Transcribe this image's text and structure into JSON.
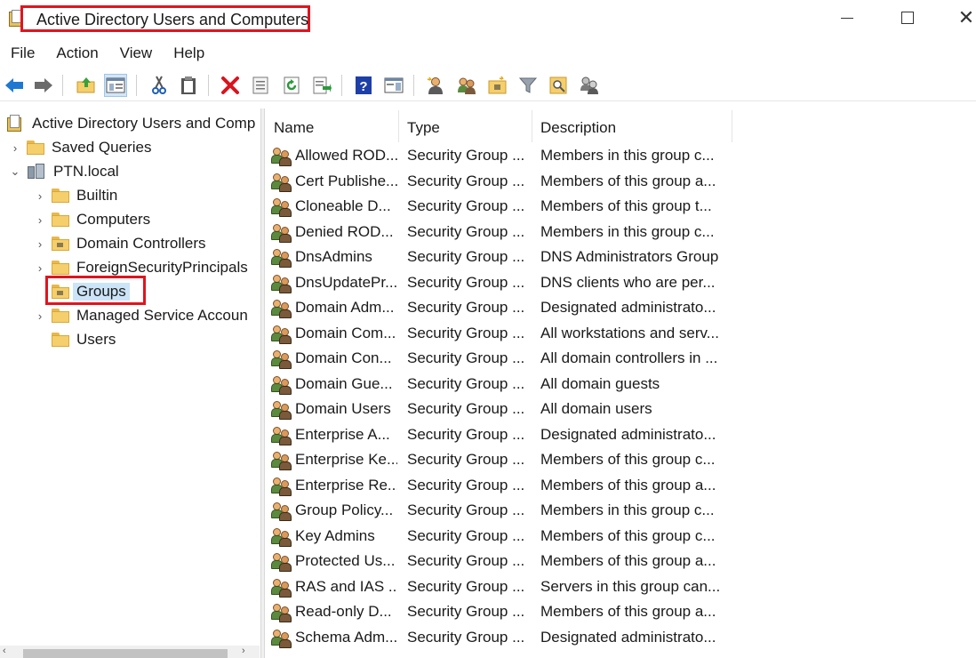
{
  "window": {
    "title": "Active Directory Users and Computers",
    "controls": {
      "minimize": "—",
      "maximize": "☐",
      "close": "✕"
    }
  },
  "menu": [
    "File",
    "Action",
    "View",
    "Help"
  ],
  "toolbar": {
    "icons": [
      "back-arrow-icon",
      "forward-arrow-icon",
      "folder-up-icon",
      "show-console-tree-icon",
      "cut-icon",
      "paste-icon",
      "delete-icon",
      "properties-icon",
      "refresh-icon",
      "export-list-icon",
      "help-icon",
      "action-pane-icon",
      "new-user-icon",
      "new-group-icon",
      "new-ou-icon",
      "filter-icon",
      "find-icon",
      "add-to-group-icon"
    ],
    "active": "show-console-tree-icon"
  },
  "tree": {
    "root": "Active Directory Users and Comp",
    "items": [
      {
        "label": "Saved Queries",
        "chevron": "›",
        "level": 1
      },
      {
        "label": "PTN.local",
        "chevron": "⌄",
        "level": 1
      },
      {
        "label": "Builtin",
        "chevron": "›",
        "level": 2
      },
      {
        "label": "Computers",
        "chevron": "›",
        "level": 2
      },
      {
        "label": "Domain Controllers",
        "chevron": "›",
        "level": 2
      },
      {
        "label": "ForeignSecurityPrincipals",
        "chevron": "›",
        "level": 2
      },
      {
        "label": "Groups",
        "chevron": "",
        "level": 2,
        "selected": true
      },
      {
        "label": "Managed Service Accoun",
        "chevron": "›",
        "level": 2
      },
      {
        "label": "Users",
        "chevron": "",
        "level": 2
      }
    ]
  },
  "list": {
    "columns": [
      "Name",
      "Type",
      "Description"
    ],
    "rows": [
      {
        "name": "Allowed ROD...",
        "type": "Security Group ...",
        "description": "Members in this group c..."
      },
      {
        "name": "Cert Publishe...",
        "type": "Security Group ...",
        "description": "Members of this group a..."
      },
      {
        "name": "Cloneable D...",
        "type": "Security Group ...",
        "description": "Members of this group t..."
      },
      {
        "name": "Denied ROD...",
        "type": "Security Group ...",
        "description": "Members in this group c..."
      },
      {
        "name": "DnsAdmins",
        "type": "Security Group ...",
        "description": "DNS Administrators Group"
      },
      {
        "name": "DnsUpdatePr...",
        "type": "Security Group ...",
        "description": "DNS clients who are per..."
      },
      {
        "name": "Domain Adm...",
        "type": "Security Group ...",
        "description": "Designated administrato..."
      },
      {
        "name": "Domain Com...",
        "type": "Security Group ...",
        "description": "All workstations and serv..."
      },
      {
        "name": "Domain Con...",
        "type": "Security Group ...",
        "description": "All domain controllers in ..."
      },
      {
        "name": "Domain Gue...",
        "type": "Security Group ...",
        "description": "All domain guests"
      },
      {
        "name": "Domain Users",
        "type": "Security Group ...",
        "description": "All domain users"
      },
      {
        "name": "Enterprise A...",
        "type": "Security Group ...",
        "description": "Designated administrato..."
      },
      {
        "name": "Enterprise Ke...",
        "type": "Security Group ...",
        "description": "Members of this group c..."
      },
      {
        "name": "Enterprise Re...",
        "type": "Security Group ...",
        "description": "Members of this group a..."
      },
      {
        "name": "Group Policy...",
        "type": "Security Group ...",
        "description": "Members in this group c..."
      },
      {
        "name": "Key Admins",
        "type": "Security Group ...",
        "description": "Members of this group c..."
      },
      {
        "name": "Protected Us...",
        "type": "Security Group ...",
        "description": "Members of this group a..."
      },
      {
        "name": "RAS and IAS ...",
        "type": "Security Group ...",
        "description": "Servers in this group can..."
      },
      {
        "name": "Read-only D...",
        "type": "Security Group ...",
        "description": "Members of this group a..."
      },
      {
        "name": "Schema Adm...",
        "type": "Security Group ...",
        "description": "Designated administrato..."
      }
    ]
  },
  "colors": {
    "highlight": "#e0141e",
    "selection": "#cce4f7"
  }
}
